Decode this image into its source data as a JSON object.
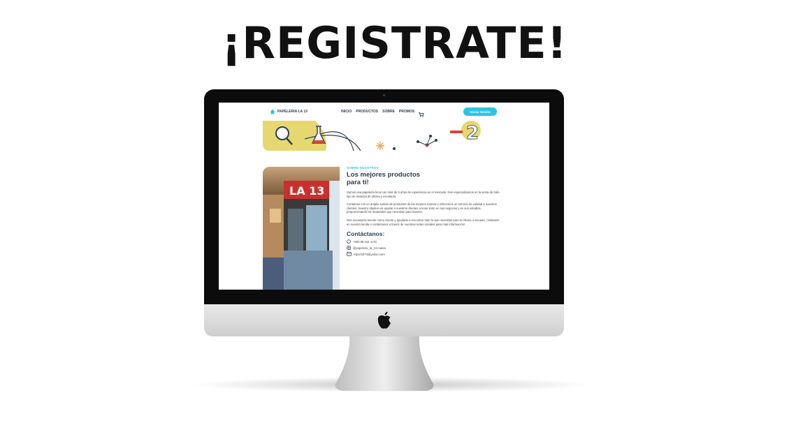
{
  "headline": "¡REGISTRATE!",
  "site": {
    "brand": "PAPELERIA LA 13",
    "nav": [
      "INICIO",
      "PRODUCTOS",
      "SOBRE",
      "PROMOS"
    ],
    "login_button": "Iniciar Sesión",
    "storefront_sign": "LA 13",
    "about": {
      "eyebrow": "SOBRE NOSOTROS",
      "title": "Los mejores productos para ti!",
      "paragraphs": [
        "Somos una papelería local con más de 5 años de experiencia en el mercado. Nos especializamos en la venta de todo tipo de material de oficina y escolares.",
        "Contamos con un amplio surtido de productos de las mejores marcas y ofrecemos un servicio de calidad a nuestros clientes. Nuestro objetivo es ayudar a nuestros clientes a tener éxito en sus negocios y en sus estudios, proporcionando los materiales que necesitan para hacerlo.",
        "Nos encantaría tenerte como cliente y ayudarte a encontrar todo lo que necesitas para tu oficina o escuela. ¡Visítanos en nuestra tienda o contáctanos a través de nuestras redes sociales para más información!"
      ]
    },
    "contact": {
      "title": "Contáctanos:",
      "phone": "+593 99 344 4176",
      "instagram": "@papeleria_la_13.manta",
      "email": "mijovi1974@yahoo.com"
    }
  },
  "colors": {
    "accent": "#2bc4e6",
    "navy": "#2c3e50",
    "banner_yellow": "#e6d770"
  },
  "icons": [
    "home-icon",
    "cart-icon",
    "whatsapp-icon",
    "instagram-icon",
    "mail-icon",
    "apple-logo-icon",
    "magnifier-icon",
    "flask-icon"
  ]
}
